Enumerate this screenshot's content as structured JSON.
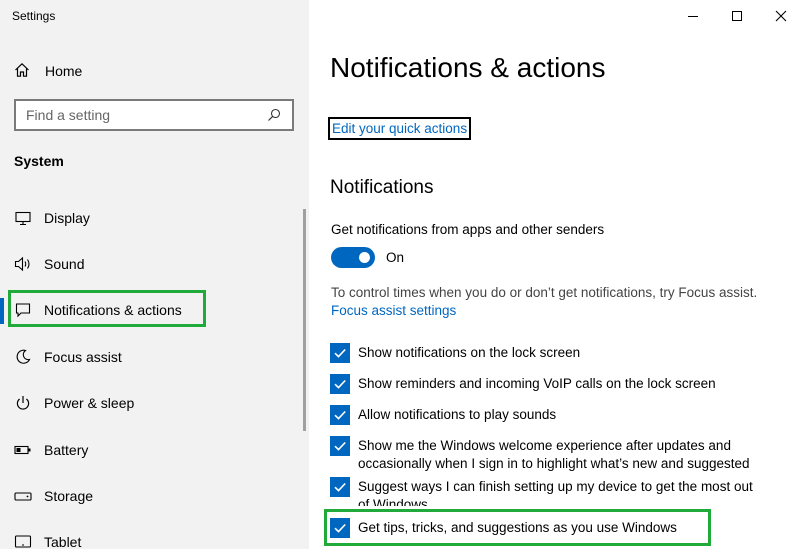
{
  "window": {
    "title": "Settings",
    "controls": [
      "minimize-icon",
      "maximize-icon",
      "close-icon"
    ]
  },
  "sidebar": {
    "home_label": "Home",
    "search_placeholder": "Find a setting",
    "section_label": "System",
    "items": [
      {
        "label": "Display",
        "icon": "display-icon"
      },
      {
        "label": "Sound",
        "icon": "sound-icon"
      },
      {
        "label": "Notifications & actions",
        "icon": "notifications-icon",
        "active": true
      },
      {
        "label": "Focus assist",
        "icon": "focus-assist-icon"
      },
      {
        "label": "Power & sleep",
        "icon": "power-icon"
      },
      {
        "label": "Battery",
        "icon": "battery-icon"
      },
      {
        "label": "Storage",
        "icon": "storage-icon"
      },
      {
        "label": "Tablet",
        "icon": "tablet-icon"
      }
    ]
  },
  "main": {
    "title": "Notifications & actions",
    "quick_actions_link": "Edit your quick actions",
    "notifications_heading": "Notifications",
    "get_notifications_label": "Get notifications from apps and other senders",
    "toggle_state": "On",
    "focus_info": "To control times when you do or don’t get notifications, try Focus assist.",
    "focus_link": "Focus assist settings",
    "checkboxes": [
      {
        "line1": "Show notifications on the lock screen",
        "line2": "",
        "checked": true
      },
      {
        "line1": "Show reminders and incoming VoIP calls on the lock screen",
        "line2": "",
        "checked": true
      },
      {
        "line1": "Allow notifications to play sounds",
        "line2": "",
        "checked": true
      },
      {
        "line1": "Show me the Windows welcome experience after updates and",
        "line2": "occasionally when I sign in to highlight what’s new and suggested",
        "checked": true
      },
      {
        "line1": "Suggest ways I can finish setting up my device to get the most out",
        "line2": "of Windows",
        "checked": true
      },
      {
        "line1": "Get tips, tricks, and suggestions as you use Windows",
        "line2": "",
        "checked": true
      }
    ]
  },
  "colors": {
    "accent": "#0067c0",
    "highlight_box": "#1faa3a",
    "sidebar_bg": "#f2f2f2"
  }
}
